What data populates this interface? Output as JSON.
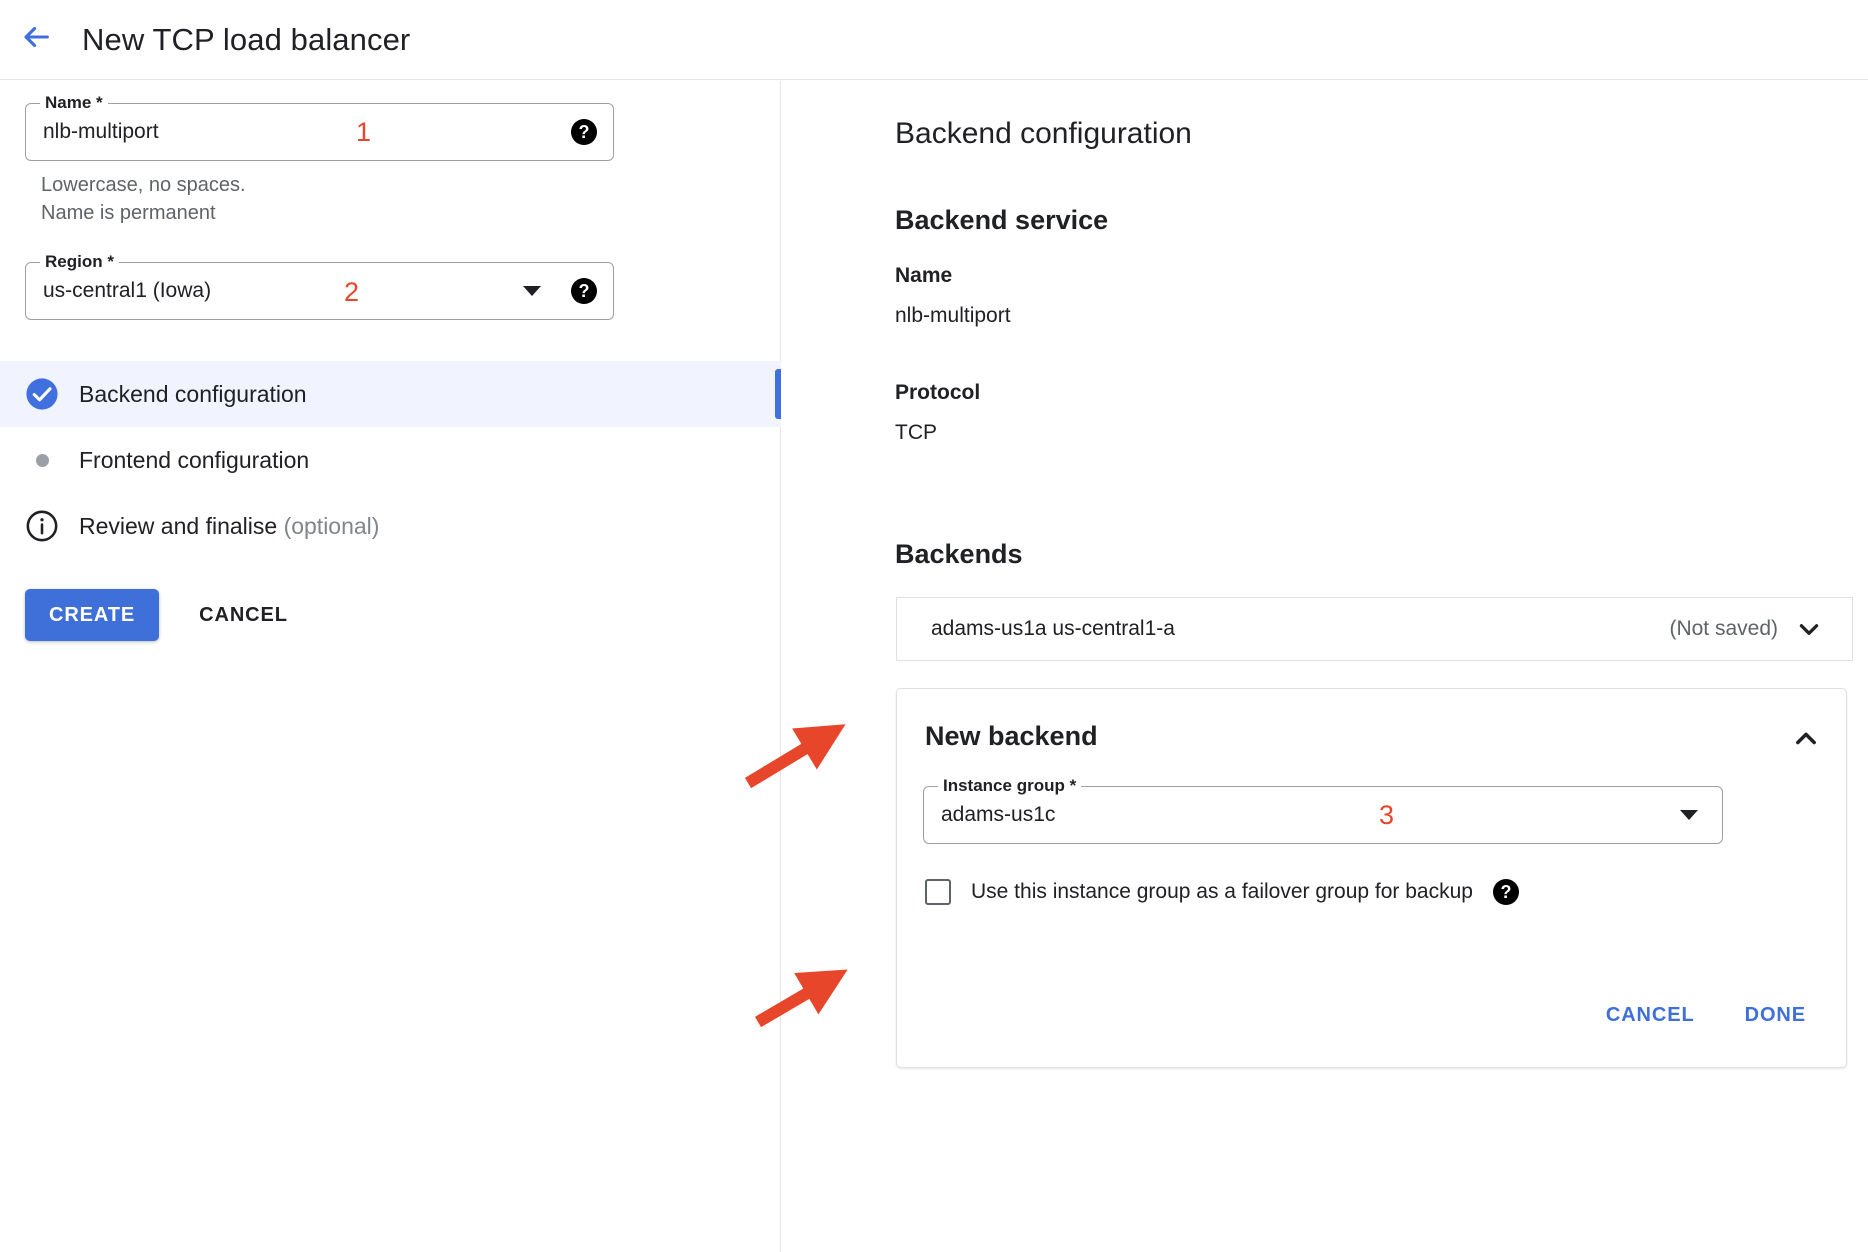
{
  "header": {
    "back_icon": "arrow-left-icon",
    "title": "New TCP load balancer"
  },
  "left_panel": {
    "name_field": {
      "label": "Name  *",
      "value": "nlb-multiport",
      "annotation": "1",
      "help_icon": "help-icon"
    },
    "name_hint_line1": "Lowercase, no spaces.",
    "name_hint_line2": "Name is permanent",
    "region_field": {
      "label": "Region *",
      "value": "us-central1 (Iowa)",
      "annotation": "2",
      "dropdown_icon": "caret-down-icon",
      "help_icon": "help-icon"
    },
    "steps": [
      {
        "label": "Backend configuration",
        "icon": "check-circle-icon",
        "state": "complete",
        "active": true
      },
      {
        "label": "Frontend configuration",
        "icon": "dot-icon",
        "state": "pending",
        "active": false
      },
      {
        "label": "Review and finalise ",
        "optional": "(optional)",
        "icon": "info-circle-icon",
        "state": "optional",
        "active": false
      }
    ],
    "create_label": "CREATE",
    "cancel_label": "CANCEL"
  },
  "right_panel": {
    "backend_configuration_heading": "Backend configuration",
    "backend_service_heading": "Backend service",
    "service_name_label": "Name",
    "service_name_value": "nlb-multiport",
    "service_protocol_label": "Protocol",
    "service_protocol_value": "TCP",
    "backends_heading": "Backends",
    "backend_rows": [
      {
        "name": "adams-us1a us-central1-a",
        "status": "(Not saved)",
        "chevron": "chevron-down-icon"
      }
    ],
    "new_backend": {
      "title": "New backend",
      "collapse_icon": "chevron-up-icon",
      "instance_group": {
        "label": "Instance group *",
        "value": "adams-us1c",
        "annotation": "3",
        "dropdown_icon": "caret-down-icon"
      },
      "failover_label": "Use this instance group as a failover group for backup",
      "failover_checked": false,
      "failover_help_icon": "help-icon",
      "cancel_label": "CANCEL",
      "done_label": "DONE"
    }
  },
  "colors": {
    "accent_blue": "#3f6fd8",
    "annotation_red": "#e8462a",
    "active_row_bg": "#f1f3fe",
    "muted_text": "#5f6368"
  }
}
